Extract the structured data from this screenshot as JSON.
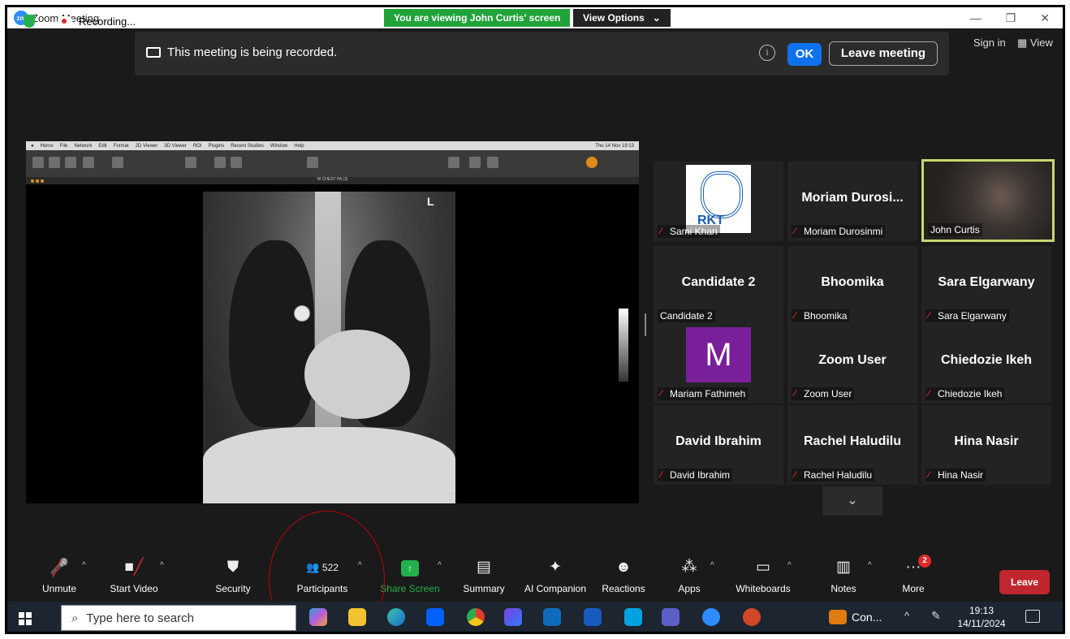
{
  "window": {
    "title": "Zoom Meeting",
    "viewing_label": "You are viewing John Curtis' screen",
    "view_options_label": "View Options"
  },
  "topbar": {
    "recording_label": "Recording...",
    "banner_message": "This meeting is being recorded.",
    "info_label": "i",
    "ok_label": "OK",
    "leave_meeting_label": "Leave meeting",
    "sign_in_label": "Sign in",
    "view_label": "View"
  },
  "shared_screen": {
    "app_menu": [
      "Horos",
      "File",
      "Network",
      "Edit",
      "Format",
      "2D Viewer",
      "3D Viewer",
      "ROI",
      "Plugins",
      "Recent Studies",
      "Window",
      "Help"
    ],
    "menubar_time": "Thu 14 Nov 19:13",
    "series_label": "W CHEST PA (3)",
    "xray_marker": "L"
  },
  "gallery": {
    "tiles": [
      {
        "big_name": "",
        "label": "Sami Khan",
        "muted": true,
        "kind": "logo"
      },
      {
        "big_name": "Moriam  Durosi...",
        "label": "Moriam Durosinmi",
        "muted": true,
        "kind": "name"
      },
      {
        "big_name": "",
        "label": "John Curtis",
        "muted": false,
        "kind": "video"
      },
      {
        "big_name": "Candidate 2",
        "label": "Candidate 2",
        "muted": false,
        "kind": "name"
      },
      {
        "big_name": "Bhoomika",
        "label": "Bhoomika",
        "muted": true,
        "kind": "name"
      },
      {
        "big_name": "Sara Elgarwany",
        "label": "Sara Elgarwany",
        "muted": true,
        "kind": "name"
      },
      {
        "big_name": "M",
        "label": "Mariam Fathimeh",
        "muted": true,
        "kind": "avatar"
      },
      {
        "big_name": "Zoom User",
        "label": "Zoom User",
        "muted": true,
        "kind": "name"
      },
      {
        "big_name": "Chiedozie Ikeh",
        "label": "Chiedozie Ikeh",
        "muted": true,
        "kind": "name"
      },
      {
        "big_name": "David Ibrahim",
        "label": "David Ibrahim",
        "muted": true,
        "kind": "name"
      },
      {
        "big_name": "Rachel Haludilu",
        "label": "Rachel Haludilu",
        "muted": true,
        "kind": "name"
      },
      {
        "big_name": "Hina Nasir",
        "label": "Hina Nasir",
        "muted": true,
        "kind": "name"
      }
    ]
  },
  "toolbar": {
    "unmute": "Unmute",
    "start_video": "Start Video",
    "security": "Security",
    "participants": "Participants",
    "participant_count": "522",
    "share_screen": "Share Screen",
    "summary": "Summary",
    "ai_companion": "AI Companion",
    "reactions": "Reactions",
    "apps": "Apps",
    "whiteboards": "Whiteboards",
    "notes": "Notes",
    "more": "More",
    "more_badge": "2",
    "leave": "Leave",
    "accent_green": "#23b14d",
    "leave_red": "#c0262e"
  },
  "taskbar": {
    "search_placeholder": "Type here to search",
    "con_label": "Con...",
    "time": "19:13",
    "date": "14/11/2024"
  }
}
